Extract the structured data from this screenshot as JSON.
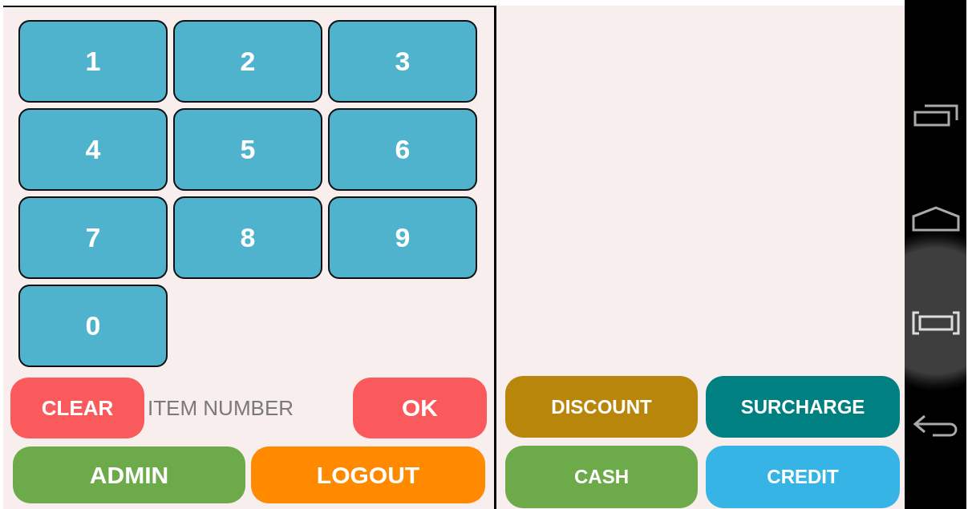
{
  "keypad": {
    "keys": [
      "1",
      "2",
      "3",
      "4",
      "5",
      "6",
      "7",
      "8",
      "9",
      "0"
    ]
  },
  "entry": {
    "clear": {
      "label": "CLEAR",
      "color": "#fa5a5c"
    },
    "item_number": {
      "placeholder": "ITEM NUMBER"
    },
    "ok": {
      "label": "OK",
      "color": "#fa5a5c"
    }
  },
  "actions": [
    {
      "label": "ADMIN",
      "color": "#6dab4a"
    },
    {
      "label": "LOGOUT",
      "color": "#ff8a00"
    }
  ],
  "payment_buttons": [
    {
      "label": "DISCOUNT",
      "color": "#b8860b"
    },
    {
      "label": "SURCHARGE",
      "color": "#008080"
    },
    {
      "label": "CASH",
      "color": "#6dab4a"
    },
    {
      "label": "CREDIT",
      "color": "#36b4e5"
    }
  ],
  "nav_bar": {
    "buttons": [
      {
        "kind": "recents"
      },
      {
        "kind": "home"
      },
      {
        "kind": "screenshot"
      },
      {
        "kind": "back"
      }
    ]
  }
}
